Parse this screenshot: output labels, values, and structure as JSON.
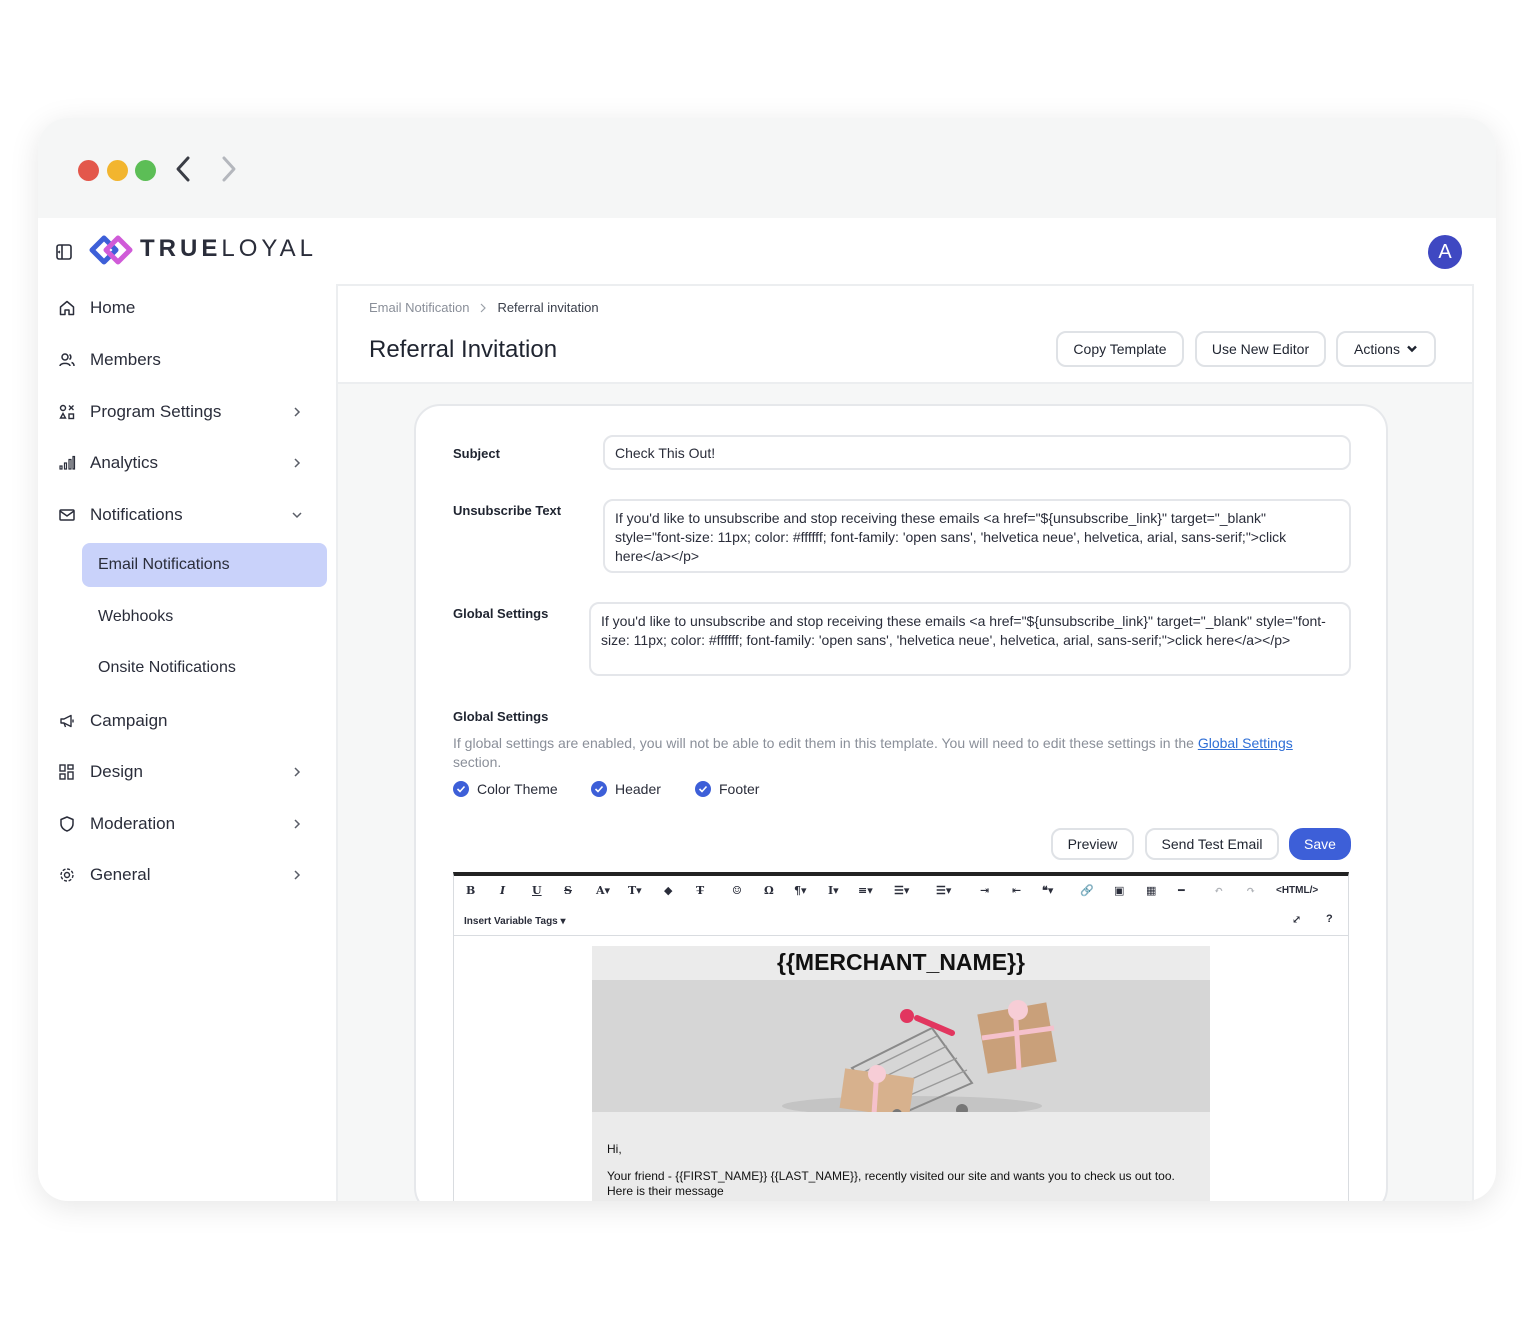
{
  "window": {
    "back_icon": "chevron-left-icon",
    "forward_icon": "chevron-right-icon"
  },
  "brand": {
    "name_bold": "TRUE",
    "name_light": "LOYAL"
  },
  "user": {
    "avatar_initial": "A"
  },
  "sidebar": {
    "items": [
      {
        "label": "Home",
        "icon": "home-icon"
      },
      {
        "label": "Members",
        "icon": "users-icon"
      },
      {
        "label": "Program Settings",
        "icon": "program-icon"
      },
      {
        "label": "Analytics",
        "icon": "analytics-icon"
      },
      {
        "label": "Notifications",
        "icon": "mail-icon"
      },
      {
        "label": "Campaign",
        "icon": "megaphone-icon"
      },
      {
        "label": "Design",
        "icon": "design-icon"
      },
      {
        "label": "Moderation",
        "icon": "shield-icon"
      },
      {
        "label": "General",
        "icon": "gear-icon"
      }
    ],
    "sub_items": [
      {
        "label": "Email Notifications"
      },
      {
        "label": "Webhooks"
      },
      {
        "label": "Onsite Notifications"
      }
    ]
  },
  "header": {
    "breadcrumb": [
      "Email Notification",
      "Referral invitation"
    ],
    "title": "Referral Invitation",
    "copy_template": "Copy Template",
    "use_new_editor": "Use New Editor",
    "actions": "Actions"
  },
  "form": {
    "subject_label": "Subject",
    "subject_value": "Check This Out!",
    "unsubscribe_label": "Unsubscribe Text",
    "unsubscribe_value": "If you'd like to unsubscribe and stop receiving these emails <a href=\"${unsubscribe_link}\" target=\"_blank\" style=\"font-size: 11px; color: #ffffff; font-family: 'open sans', 'helvetica neue', helvetica, arial, sans-serif;\">click here</a></p>",
    "global_label": "Global Settings",
    "global_value": "If you'd like to unsubscribe and stop receiving these emails <a href=\"${unsubscribe_link}\" target=\"_blank\" style=\"font-size: 11px; color: #ffffff; font-family: 'open sans', 'helvetica neue', helvetica, arial, sans-serif;\">click here</a></p>",
    "global_section_label": "Global Settings",
    "global_desc_pre": "If global settings are enabled, you will not be able to edit them in this template. You will need to edit these settings in the ",
    "global_desc_link": "Global Settings",
    "global_desc_post": " section.",
    "checks": [
      {
        "label": "Color Theme",
        "checked": true
      },
      {
        "label": "Header",
        "checked": true
      },
      {
        "label": "Footer",
        "checked": true
      }
    ],
    "preview": "Preview",
    "send_test": "Send Test Email",
    "save": "Save"
  },
  "editor": {
    "tools": [
      "B",
      "I",
      "U",
      "S",
      "A▾",
      "T▾",
      "◆",
      "T̶",
      "☺",
      "Ω",
      "¶▾",
      "I▾",
      "≡▾",
      "☰▾",
      "☰▾",
      "⇥",
      "⇤",
      "❝▾",
      "🔗",
      "▣",
      "▦",
      "━",
      "↶",
      "↷",
      "<HTML/>"
    ],
    "insert_variable": "Insert Variable Tags ▾",
    "expand": "⤢",
    "help": "?",
    "merchant_name": "{{MERCHANT_NAME}}",
    "greeting": "Hi,",
    "body_line1": "Your friend - {{FIRST_NAME}} {{LAST_NAME}}, recently visited our site and wants you to check us out too.",
    "body_line2": "Here is their message"
  },
  "colors": {
    "accent": "#3d5fd8",
    "active_nav": "#c9d2fa",
    "avatar": "#3f48c2"
  }
}
